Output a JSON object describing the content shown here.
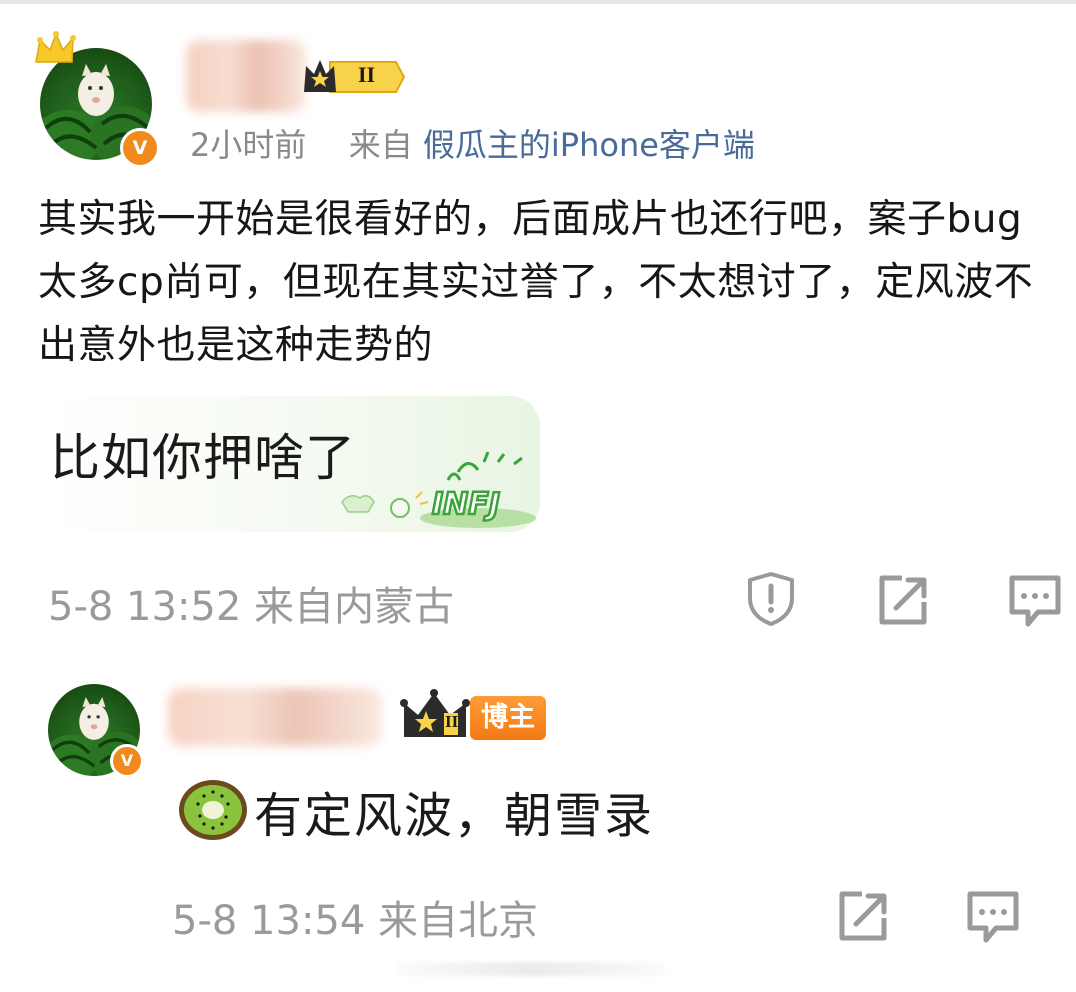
{
  "post": {
    "meta_time": "2小时前",
    "meta_from": "来自",
    "meta_client": "假瓜主的iPhone客户端",
    "body": "其实我一开始是很看好的，后面成片也还行吧，案子bug太多cp尚可，但现在其实过誉了，不太想讨了，定风波不出意外也是这种走势的",
    "level_badge": "II",
    "verified_mark": "V"
  },
  "reply1": {
    "text": "比如你押啥了",
    "bubble_logo_text": "INFJ",
    "time_location": "5-8 13:52 来自内蒙古",
    "actions": [
      "report-icon",
      "share-icon",
      "comment-icon"
    ]
  },
  "reply2": {
    "level_badge": "II",
    "host_tag": "博主",
    "emoji": "kiwi-icon",
    "text": "有定风波，朝雪录",
    "time_location": "5-8 13:54 来自北京",
    "verified_mark": "V",
    "actions": [
      "share-icon",
      "comment-icon"
    ]
  },
  "colors": {
    "link": "#4a6a98",
    "meta_gray": "#8a8a8a",
    "time_gray": "#9a9a9a",
    "verify_orange": "#f08a1c",
    "host_tag_orange": "#f37a14",
    "badge_gold": "#f6c82a"
  }
}
